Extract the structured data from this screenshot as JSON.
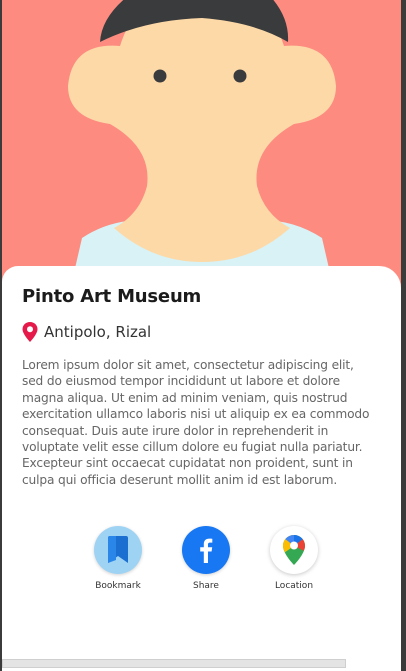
{
  "place": {
    "title": "Pinto Art Museum",
    "location": "Antipolo, Rizal",
    "description": "Lorem ipsum dolor sit amet, consectetur adipiscing elit, sed do eiusmod tempor incididunt ut labore et dolore magna aliqua. Ut enim ad minim veniam, quis nostrud exercitation ullamco laboris nisi ut aliquip ex ea commodo consequat. Duis aute irure dolor in reprehenderit in voluptate velit esse cillum dolore eu fugiat nulla pariatur. Excepteur sint occaecat cupidatat non proident, sunt in culpa qui officia deserunt mollit anim id est laborum."
  },
  "actions": {
    "bookmark": {
      "label": "Bookmark",
      "icon": "bookmark-icon"
    },
    "share": {
      "label": "Share",
      "icon": "facebook-icon"
    },
    "location": {
      "label": "Location",
      "icon": "google-maps-icon"
    }
  },
  "colors": {
    "hero_background": "#fd8b80",
    "location_pin": "#e5194a",
    "share_button": "#1877f2",
    "bookmark_button": "#9fd3f3"
  }
}
